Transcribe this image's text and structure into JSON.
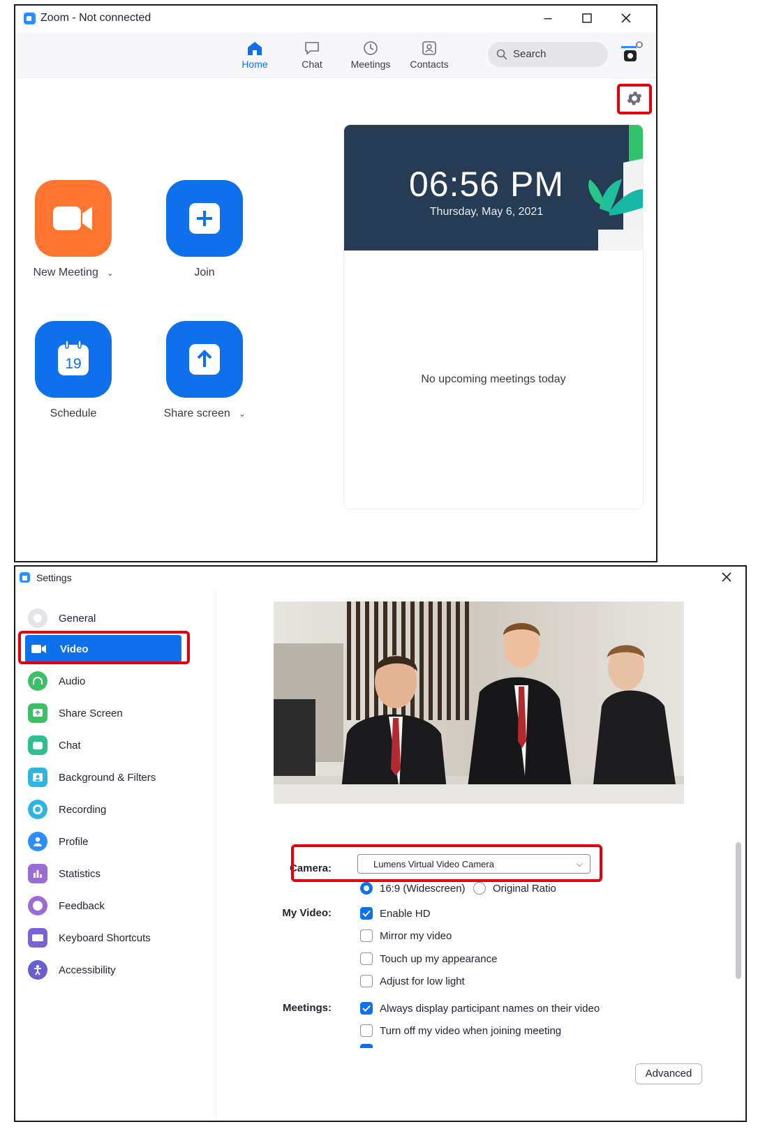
{
  "zoom_window": {
    "title": "Zoom - Not connected",
    "nav": [
      {
        "label": "Home",
        "icon": "home-icon"
      },
      {
        "label": "Chat",
        "icon": "chat-icon"
      },
      {
        "label": "Meetings",
        "icon": "clock-icon"
      },
      {
        "label": "Contacts",
        "icon": "contacts-icon"
      }
    ],
    "search_label": "Search",
    "actions": {
      "new_meeting": "New Meeting",
      "join": "Join",
      "schedule": "Schedule",
      "schedule_day": "19",
      "share_screen": "Share screen"
    },
    "clock": {
      "time": "06:56 PM",
      "date": "Thursday, May 6, 2021"
    },
    "empty_meetings": "No upcoming meetings today",
    "colors": {
      "accent": "#0e71eb",
      "orange": "#ff742e",
      "highlight": "#e00010"
    }
  },
  "settings_window": {
    "title": "Settings",
    "sidebar": [
      {
        "label": "General",
        "icon": "gear-icon",
        "color": "#b7b7bd"
      },
      {
        "label": "Video",
        "icon": "video-camera-icon",
        "color": "#0e71eb"
      },
      {
        "label": "Audio",
        "icon": "headphones-icon",
        "color": "#3dbf66"
      },
      {
        "label": "Share Screen",
        "icon": "share-screen-icon",
        "color": "#3dbf66"
      },
      {
        "label": "Chat",
        "icon": "chat-icon",
        "color": "#2fbf8e"
      },
      {
        "label": "Background & Filters",
        "icon": "background-icon",
        "color": "#30b5e0"
      },
      {
        "label": "Recording",
        "icon": "recording-icon",
        "color": "#30b5e0"
      },
      {
        "label": "Profile",
        "icon": "profile-icon",
        "color": "#2d8cff"
      },
      {
        "label": "Statistics",
        "icon": "statistics-icon",
        "color": "#9b6bd6"
      },
      {
        "label": "Feedback",
        "icon": "feedback-icon",
        "color": "#9b6bd6"
      },
      {
        "label": "Keyboard Shortcuts",
        "icon": "keyboard-icon",
        "color": "#7a62d6"
      },
      {
        "label": "Accessibility",
        "icon": "accessibility-icon",
        "color": "#6a5fd0"
      }
    ],
    "camera": {
      "label": "Camera:",
      "value": "Lumens Virtual Video Camera"
    },
    "ratio": [
      {
        "label": "16:9 (Widescreen)",
        "selected": true
      },
      {
        "label": "Original Ratio",
        "selected": false
      }
    ],
    "my_video": {
      "label": "My Video:",
      "options": [
        {
          "label": "Enable HD",
          "checked": true
        },
        {
          "label": "Mirror my video",
          "checked": false
        },
        {
          "label": "Touch up my appearance",
          "checked": false
        },
        {
          "label": "Adjust for low light",
          "checked": false
        }
      ]
    },
    "meetings": {
      "label": "Meetings:",
      "options": [
        {
          "label": "Always display participant names on their video",
          "checked": true
        },
        {
          "label": "Turn off my video when joining meeting",
          "checked": false
        }
      ]
    },
    "advanced_label": "Advanced"
  }
}
